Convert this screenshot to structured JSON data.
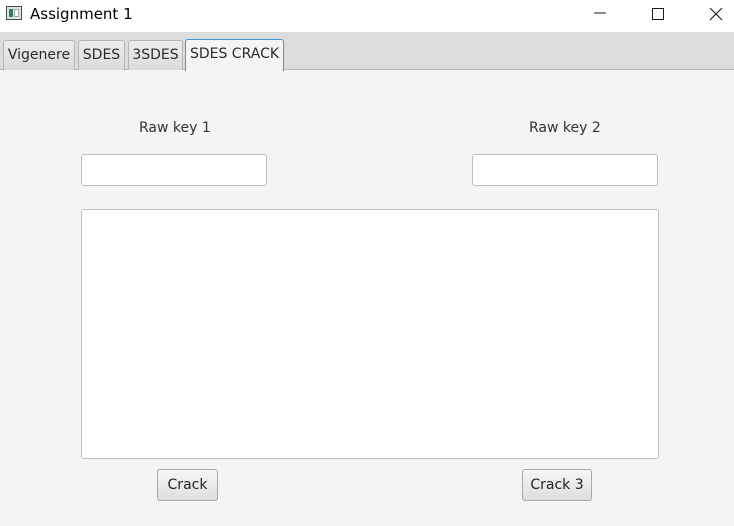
{
  "window": {
    "title": "Assignment 1"
  },
  "icons": {
    "app": "app-window-icon",
    "minimize": "minimize-icon",
    "maximize": "maximize-icon",
    "close": "close-icon"
  },
  "tabs": [
    {
      "label": "Vigenere",
      "selected": false
    },
    {
      "label": "SDES",
      "selected": false
    },
    {
      "label": "3SDES",
      "selected": false
    },
    {
      "label": "SDES CRACK",
      "selected": true
    }
  ],
  "form": {
    "raw_key_1_label": "Raw key 1",
    "raw_key_1_value": "",
    "raw_key_2_label": "Raw key 2",
    "raw_key_2_value": "",
    "output_text": ""
  },
  "buttons": {
    "crack_label": "Crack",
    "crack3_label": "Crack 3"
  },
  "colors": {
    "selected_tab_border": "#3c9ad8",
    "background": "#f4f4f4"
  }
}
